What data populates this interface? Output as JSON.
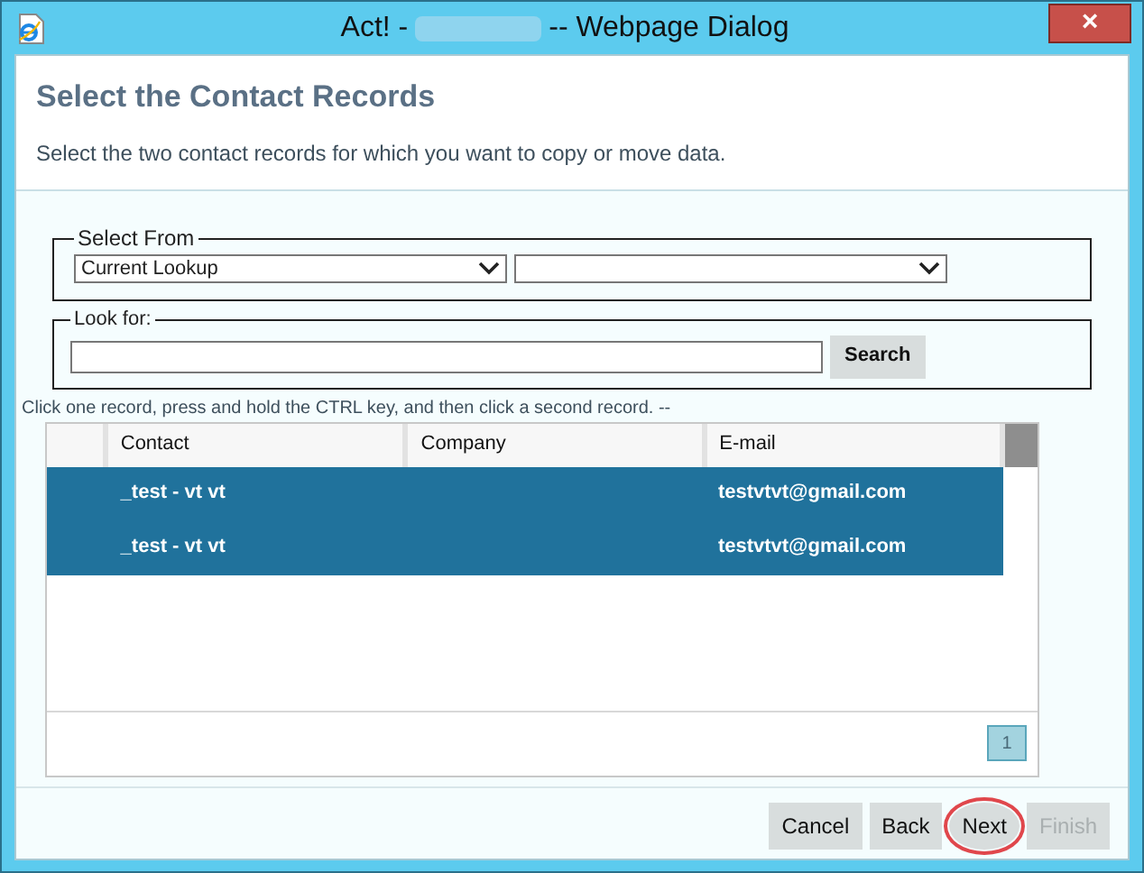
{
  "window": {
    "title_start": "Act! -",
    "title_end": "-- Webpage Dialog",
    "close": "×"
  },
  "header": {
    "title": "Select the Contact Records",
    "subtitle": "Select the two contact records for which you want to copy or move data."
  },
  "select_from": {
    "legend": "Select From",
    "dropdowns": [
      {
        "kind": "filled",
        "value": "Current Lookup"
      },
      {
        "kind": "empty"
      }
    ]
  },
  "look_for": {
    "legend": "Look for:",
    "button": "Search"
  },
  "instruction": "Click one record, press and hold the CTRL key, and then click a second record. --",
  "table": {
    "columns": [
      "Contact",
      "Company",
      "E-mail"
    ],
    "rows": [
      {
        "cells": [
          "_test - vt vt",
          "",
          "testvtvt@gmail.com"
        ],
        "selected": true
      },
      {
        "cells": [
          "_test - vt vt",
          "",
          "testvtvt@gmail.com"
        ],
        "selected": true
      }
    ]
  },
  "pager": [
    {
      "label": "1",
      "selected": true
    }
  ],
  "buttons": [
    {
      "label": "Cancel",
      "disabled": false,
      "highlighted": false
    },
    {
      "label": "Back",
      "disabled": false,
      "highlighted": false
    },
    {
      "label": "Next",
      "disabled": false,
      "highlighted": true
    },
    {
      "label": "Finish",
      "disabled": true,
      "highlighted": false
    }
  ]
}
